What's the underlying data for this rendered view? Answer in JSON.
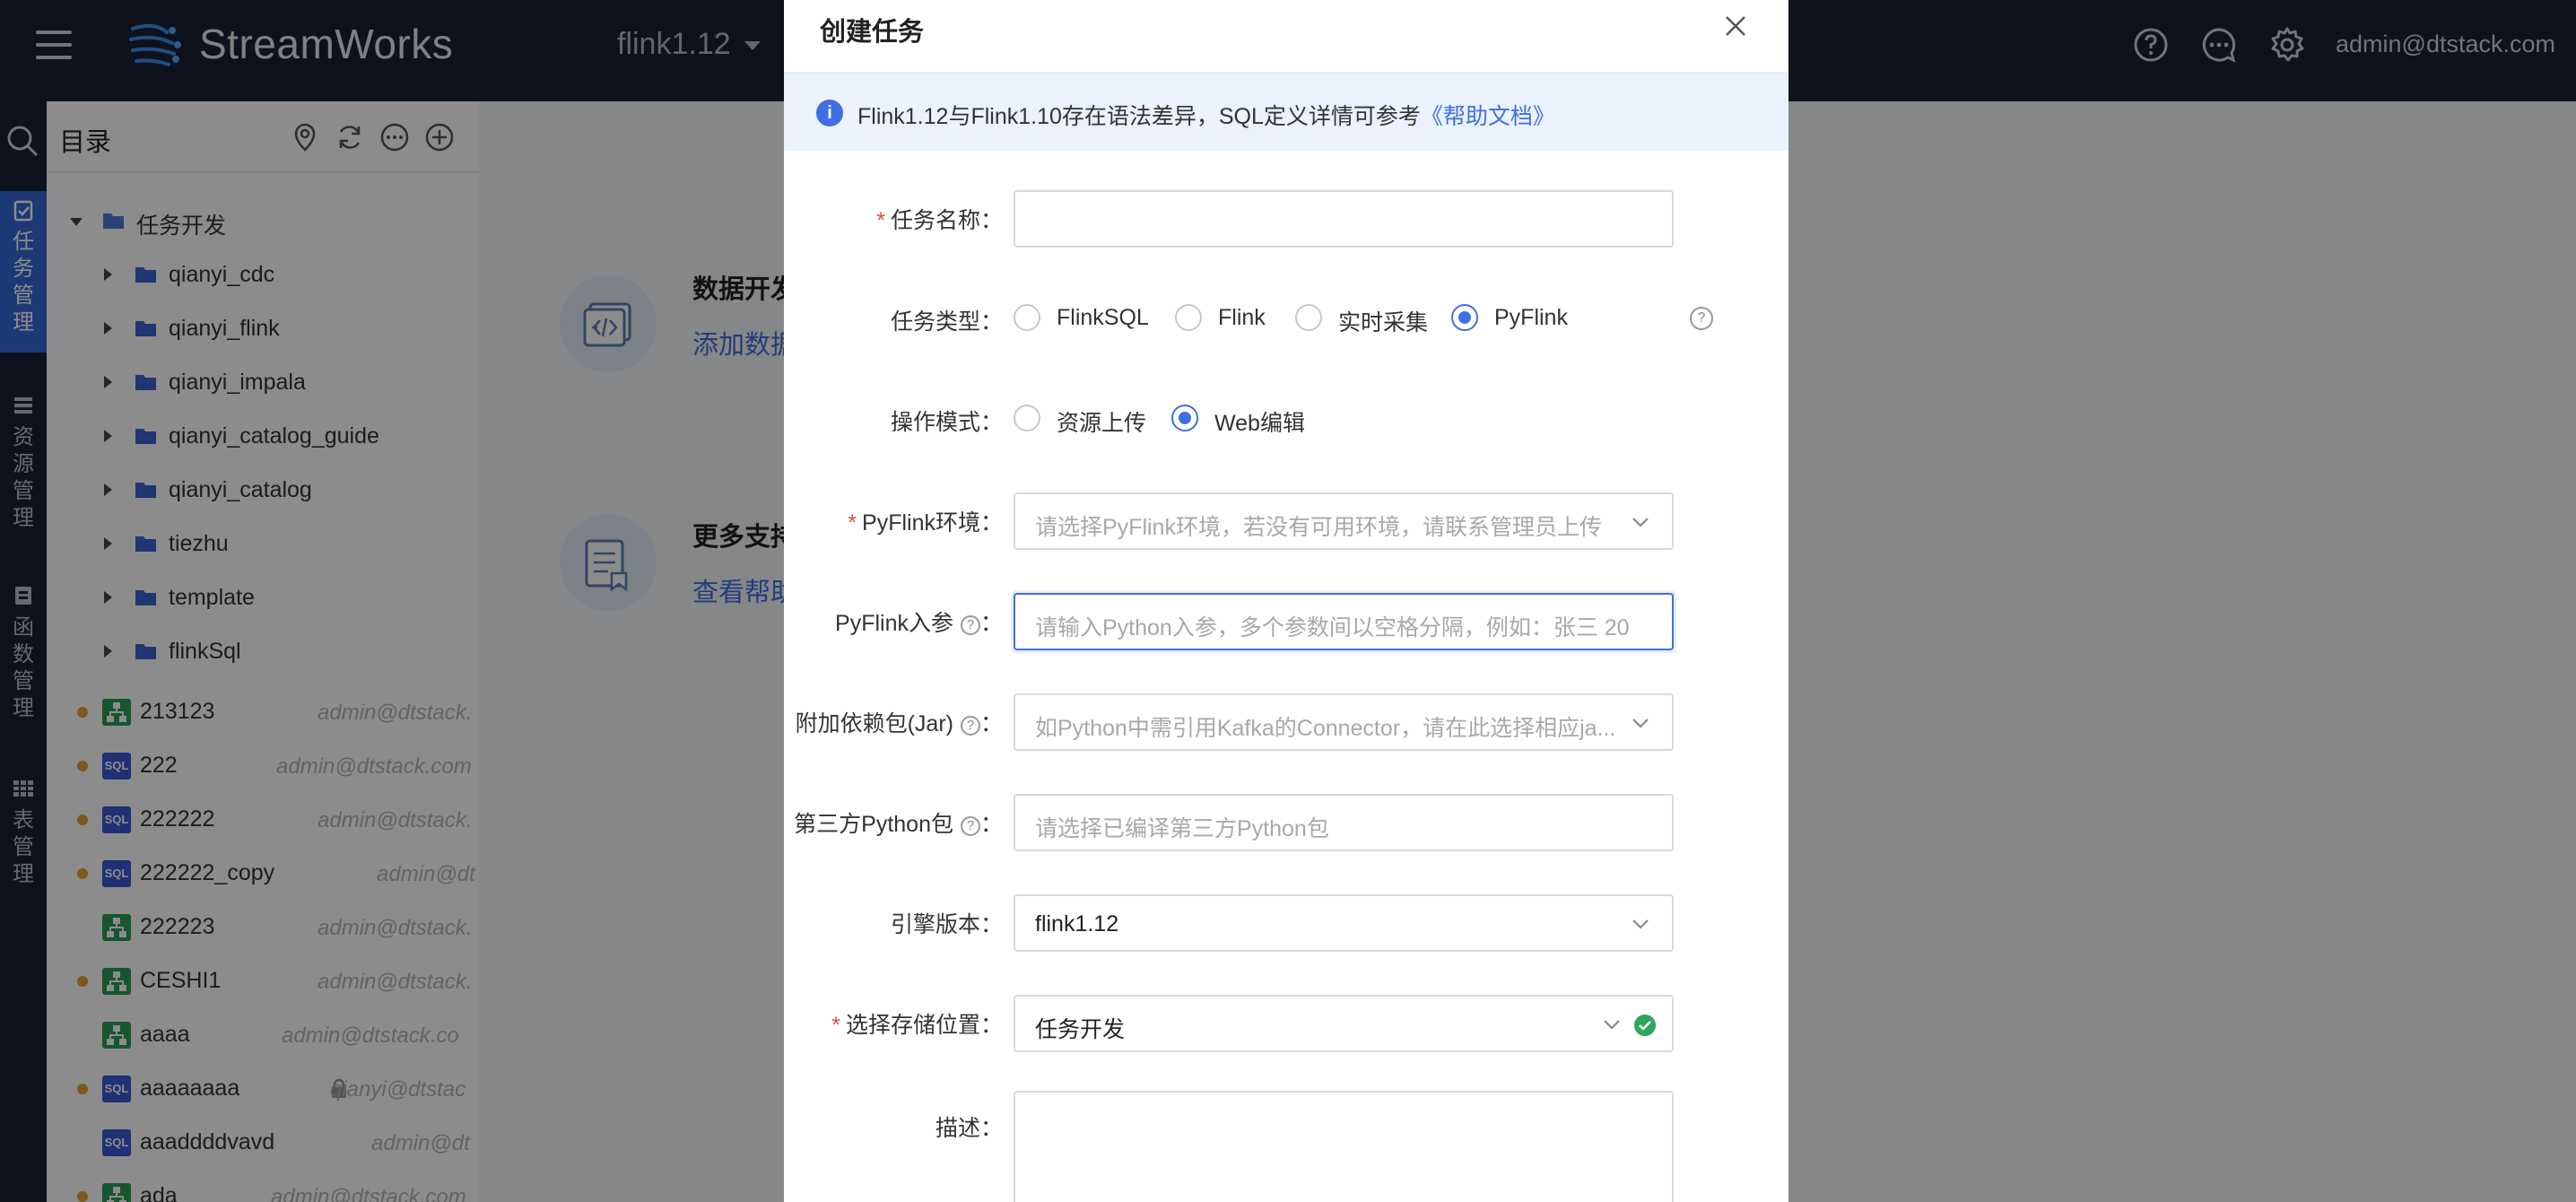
{
  "topbar": {
    "brand": "StreamWorks",
    "engine": "flink1.12",
    "user": "admin@dtstack.com",
    "icons": [
      "help-icon",
      "chat-icon",
      "settings-icon"
    ]
  },
  "leftbar": {
    "tabs": [
      {
        "label": "任务管理",
        "active": true
      },
      {
        "label": "资源管理",
        "active": false
      },
      {
        "label": "函数管理",
        "active": false
      },
      {
        "label": "表管理",
        "active": false
      }
    ]
  },
  "sidebar": {
    "title": "目录",
    "root": "任务开发",
    "folders": [
      "qianyi_cdc",
      "qianyi_flink",
      "qianyi_impala",
      "qianyi_catalog_guide",
      "qianyi_catalog",
      "tiezhu",
      "template",
      "flinkSql"
    ],
    "files": [
      {
        "name": "213123",
        "type": "flow",
        "dot": true,
        "owner": "admin@dtstack.",
        "locked": false
      },
      {
        "name": "222",
        "type": "sql",
        "dot": true,
        "owner": "admin@dtstack.com",
        "locked": false
      },
      {
        "name": "222222",
        "type": "sql",
        "dot": true,
        "owner": "admin@dtstack.",
        "locked": false
      },
      {
        "name": "222222_copy",
        "type": "sql",
        "dot": true,
        "owner": "admin@dt",
        "locked": false
      },
      {
        "name": "222223",
        "type": "flow",
        "dot": false,
        "owner": "admin@dtstack.",
        "locked": false
      },
      {
        "name": "CESHI1",
        "type": "flow",
        "dot": true,
        "owner": "admin@dtstack.",
        "locked": false
      },
      {
        "name": "aaaa",
        "type": "flow",
        "dot": false,
        "owner": "admin@dtstack.co",
        "locked": false
      },
      {
        "name": "aaaaaaaa",
        "type": "sql",
        "dot": true,
        "owner": "qianyi@dtstac",
        "locked": true
      },
      {
        "name": "aaaddddvavd",
        "type": "sql",
        "dot": false,
        "owner": "admin@dt",
        "locked": false
      },
      {
        "name": "ada",
        "type": "flow",
        "dot": true,
        "owner": "admin@dtstack.com",
        "locked": false
      }
    ]
  },
  "main": {
    "card1_title": "数据开发",
    "card1_link": "添加数据",
    "card2_title": "更多支持",
    "card2_link": "查看帮助"
  },
  "modal": {
    "title": "创建任务",
    "alert_text": "Flink1.12与Flink1.10存在语法差异，SQL定义详情可参考",
    "alert_link": "《帮助文档》",
    "task_name_label": "任务名称：",
    "task_type_label": "任务类型：",
    "task_types": [
      "FlinkSQL",
      "Flink",
      "实时采集",
      "PyFlink"
    ],
    "task_type_selected": "PyFlink",
    "mode_label": "操作模式：",
    "modes": [
      "资源上传",
      "Web编辑"
    ],
    "mode_selected": "Web编辑",
    "env_label": "PyFlink环境：",
    "env_placeholder": "请选择PyFlink环境，若没有可用环境，请联系管理员上传",
    "args_label": "PyFlink入参",
    "args_placeholder": "请输入Python入参，多个参数间以空格分隔，例如：张三 20",
    "jar_label": "附加依赖包(Jar)",
    "jar_placeholder": "如Python中需引用Kafka的Connector，请在此选择相应ja...",
    "pypkg_label": "第三方Python包",
    "pypkg_placeholder": "请选择已编译第三方Python包",
    "engine_label": "引擎版本：",
    "engine_value": "flink1.12",
    "location_label": "选择存储位置：",
    "location_value": "任务开发",
    "desc_label": "描述："
  }
}
